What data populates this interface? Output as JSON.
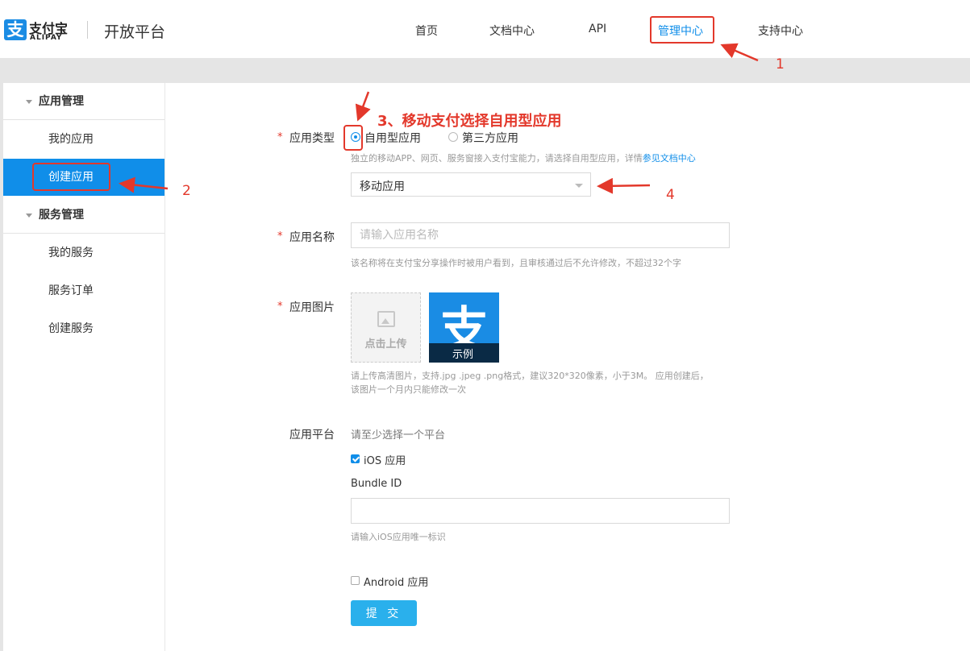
{
  "header": {
    "logo_cn": "支付宝",
    "logo_en": "ALIPAY",
    "logo_glyph": "支",
    "platform_title": "开放平台",
    "nav": [
      {
        "label": "首页"
      },
      {
        "label": "文档中心"
      },
      {
        "label": "API"
      },
      {
        "label": "管理中心",
        "active": true
      },
      {
        "label": "支持中心"
      }
    ]
  },
  "sidebar": {
    "groups": [
      {
        "label": "应用管理",
        "items": [
          {
            "label": "我的应用"
          },
          {
            "label": "创建应用",
            "active": true
          }
        ]
      },
      {
        "label": "服务管理",
        "items": [
          {
            "label": "我的服务"
          },
          {
            "label": "服务订单"
          },
          {
            "label": "创建服务"
          }
        ]
      }
    ]
  },
  "form": {
    "required_mark": "*",
    "app_type": {
      "label": "应用类型",
      "options": [
        {
          "label": "自用型应用",
          "checked": true
        },
        {
          "label": "第三方应用",
          "checked": false
        }
      ],
      "hint_prefix": "独立的移动APP、网页、服务窗接入支付宝能力，请选择自用型应用，详情",
      "hint_link": "参见文档中心",
      "select_value": "移动应用"
    },
    "app_name": {
      "label": "应用名称",
      "placeholder": "请输入应用名称",
      "hint": "该名称将在支付宝分享操作时被用户看到，且审核通过后不允许修改，不超过32个字"
    },
    "app_image": {
      "label": "应用图片",
      "upload_text": "点击上传",
      "example_label": "示例",
      "hint_line1": "请上传高清图片，支持.jpg .jpeg .png格式，建议320*320像素，小于3M。 应用创建后，",
      "hint_line2": "该图片一个月内只能修改一次"
    },
    "app_platform": {
      "label": "应用平台",
      "hint": "请至少选择一个平台",
      "ios": {
        "label": "iOS 应用",
        "checked": true
      },
      "bundle_label": "Bundle ID",
      "bundle_value": "",
      "bundle_hint": "请输入iOS应用唯一标识",
      "android": {
        "label": "Android 应用",
        "checked": false
      }
    },
    "submit_label": "提 交"
  },
  "annotations": {
    "n1": "1",
    "n2": "2",
    "n3_title": "3、移动支付选择自用型应用",
    "n4": "4"
  },
  "colors": {
    "accent": "#108ee9",
    "annotation_red": "#e3382b",
    "submit": "#2ab0ec"
  }
}
